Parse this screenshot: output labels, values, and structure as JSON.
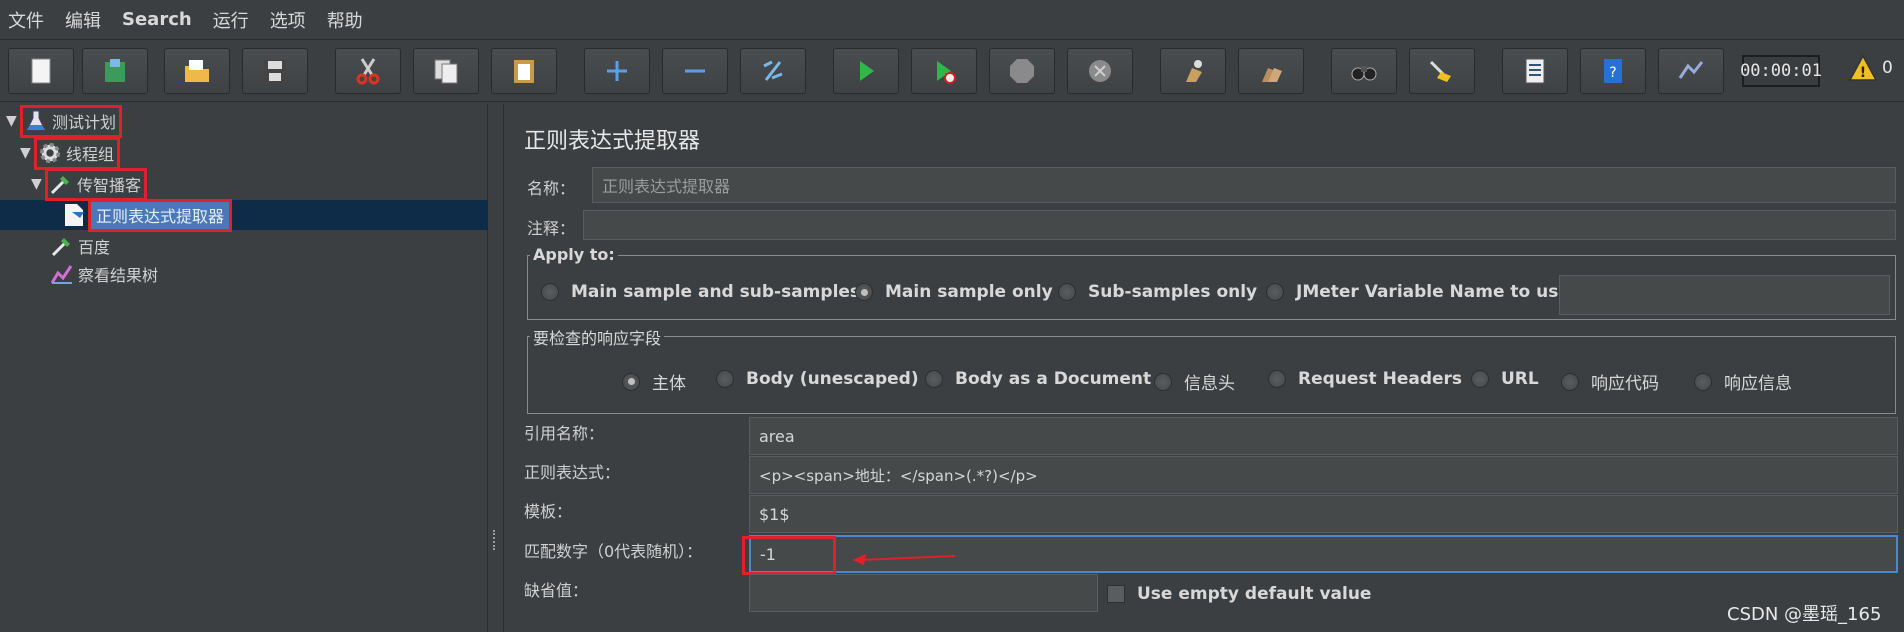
{
  "menu": [
    "文件",
    "编辑",
    "Search",
    "运行",
    "选项",
    "帮助"
  ],
  "toolbar": {
    "buttons": [
      "new-icon",
      "templates-icon",
      "open-icon",
      "save-icon",
      "cut-icon",
      "copy-icon",
      "paste-icon",
      "expand-icon",
      "collapse-icon",
      "toggle-icon",
      "start-icon",
      "start-no-pause-icon",
      "stop-icon",
      "shutdown-icon",
      "clear-icon",
      "clear-all-icon",
      "search-icon",
      "reset-search-icon",
      "function-helper-icon",
      "help-icon",
      "remote-icon"
    ],
    "timer": "00:00:01",
    "warn_count": "0"
  },
  "tree": {
    "items": [
      {
        "label": "测试计划",
        "icon": "flask-icon"
      },
      {
        "label": "线程组",
        "icon": "gear-icon"
      },
      {
        "label": "传智播客",
        "icon": "sampler-icon"
      },
      {
        "label": "正则表达式提取器",
        "icon": "extractor-icon"
      },
      {
        "label": "百度",
        "icon": "sampler-icon"
      },
      {
        "label": "察看结果树",
        "icon": "listener-icon"
      }
    ]
  },
  "panel": {
    "title": "正则表达式提取器",
    "name_label": "名称：",
    "name_value": "正则表达式提取器",
    "comment_label": "注释：",
    "comment_value": "",
    "apply_to": {
      "title": "Apply to:",
      "options": [
        "Main sample and sub-samples",
        "Main sample only",
        "Sub-samples only",
        "JMeter Variable Name to use"
      ],
      "selected": "Main sample only",
      "var_value": ""
    },
    "response_field": {
      "title": "要检查的响应字段",
      "options": [
        "主体",
        "Body (unescaped)",
        "Body as a Document",
        "信息头",
        "Request Headers",
        "URL",
        "响应代码",
        "响应信息"
      ],
      "selected": "主体"
    },
    "ref_name_label": "引用名称：",
    "ref_name_value": "area",
    "regex_label": "正则表达式：",
    "regex_value": "<p><span>地址：</span>(.*?)</p>",
    "template_label": "模板：",
    "template_value": "$1$",
    "match_no_label": "匹配数字（0代表随机）：",
    "match_no_value": "-1",
    "default_label": "缺省值：",
    "default_value": "",
    "use_empty_label": "Use empty default value"
  },
  "watermark": "CSDN @墨瑶_165"
}
